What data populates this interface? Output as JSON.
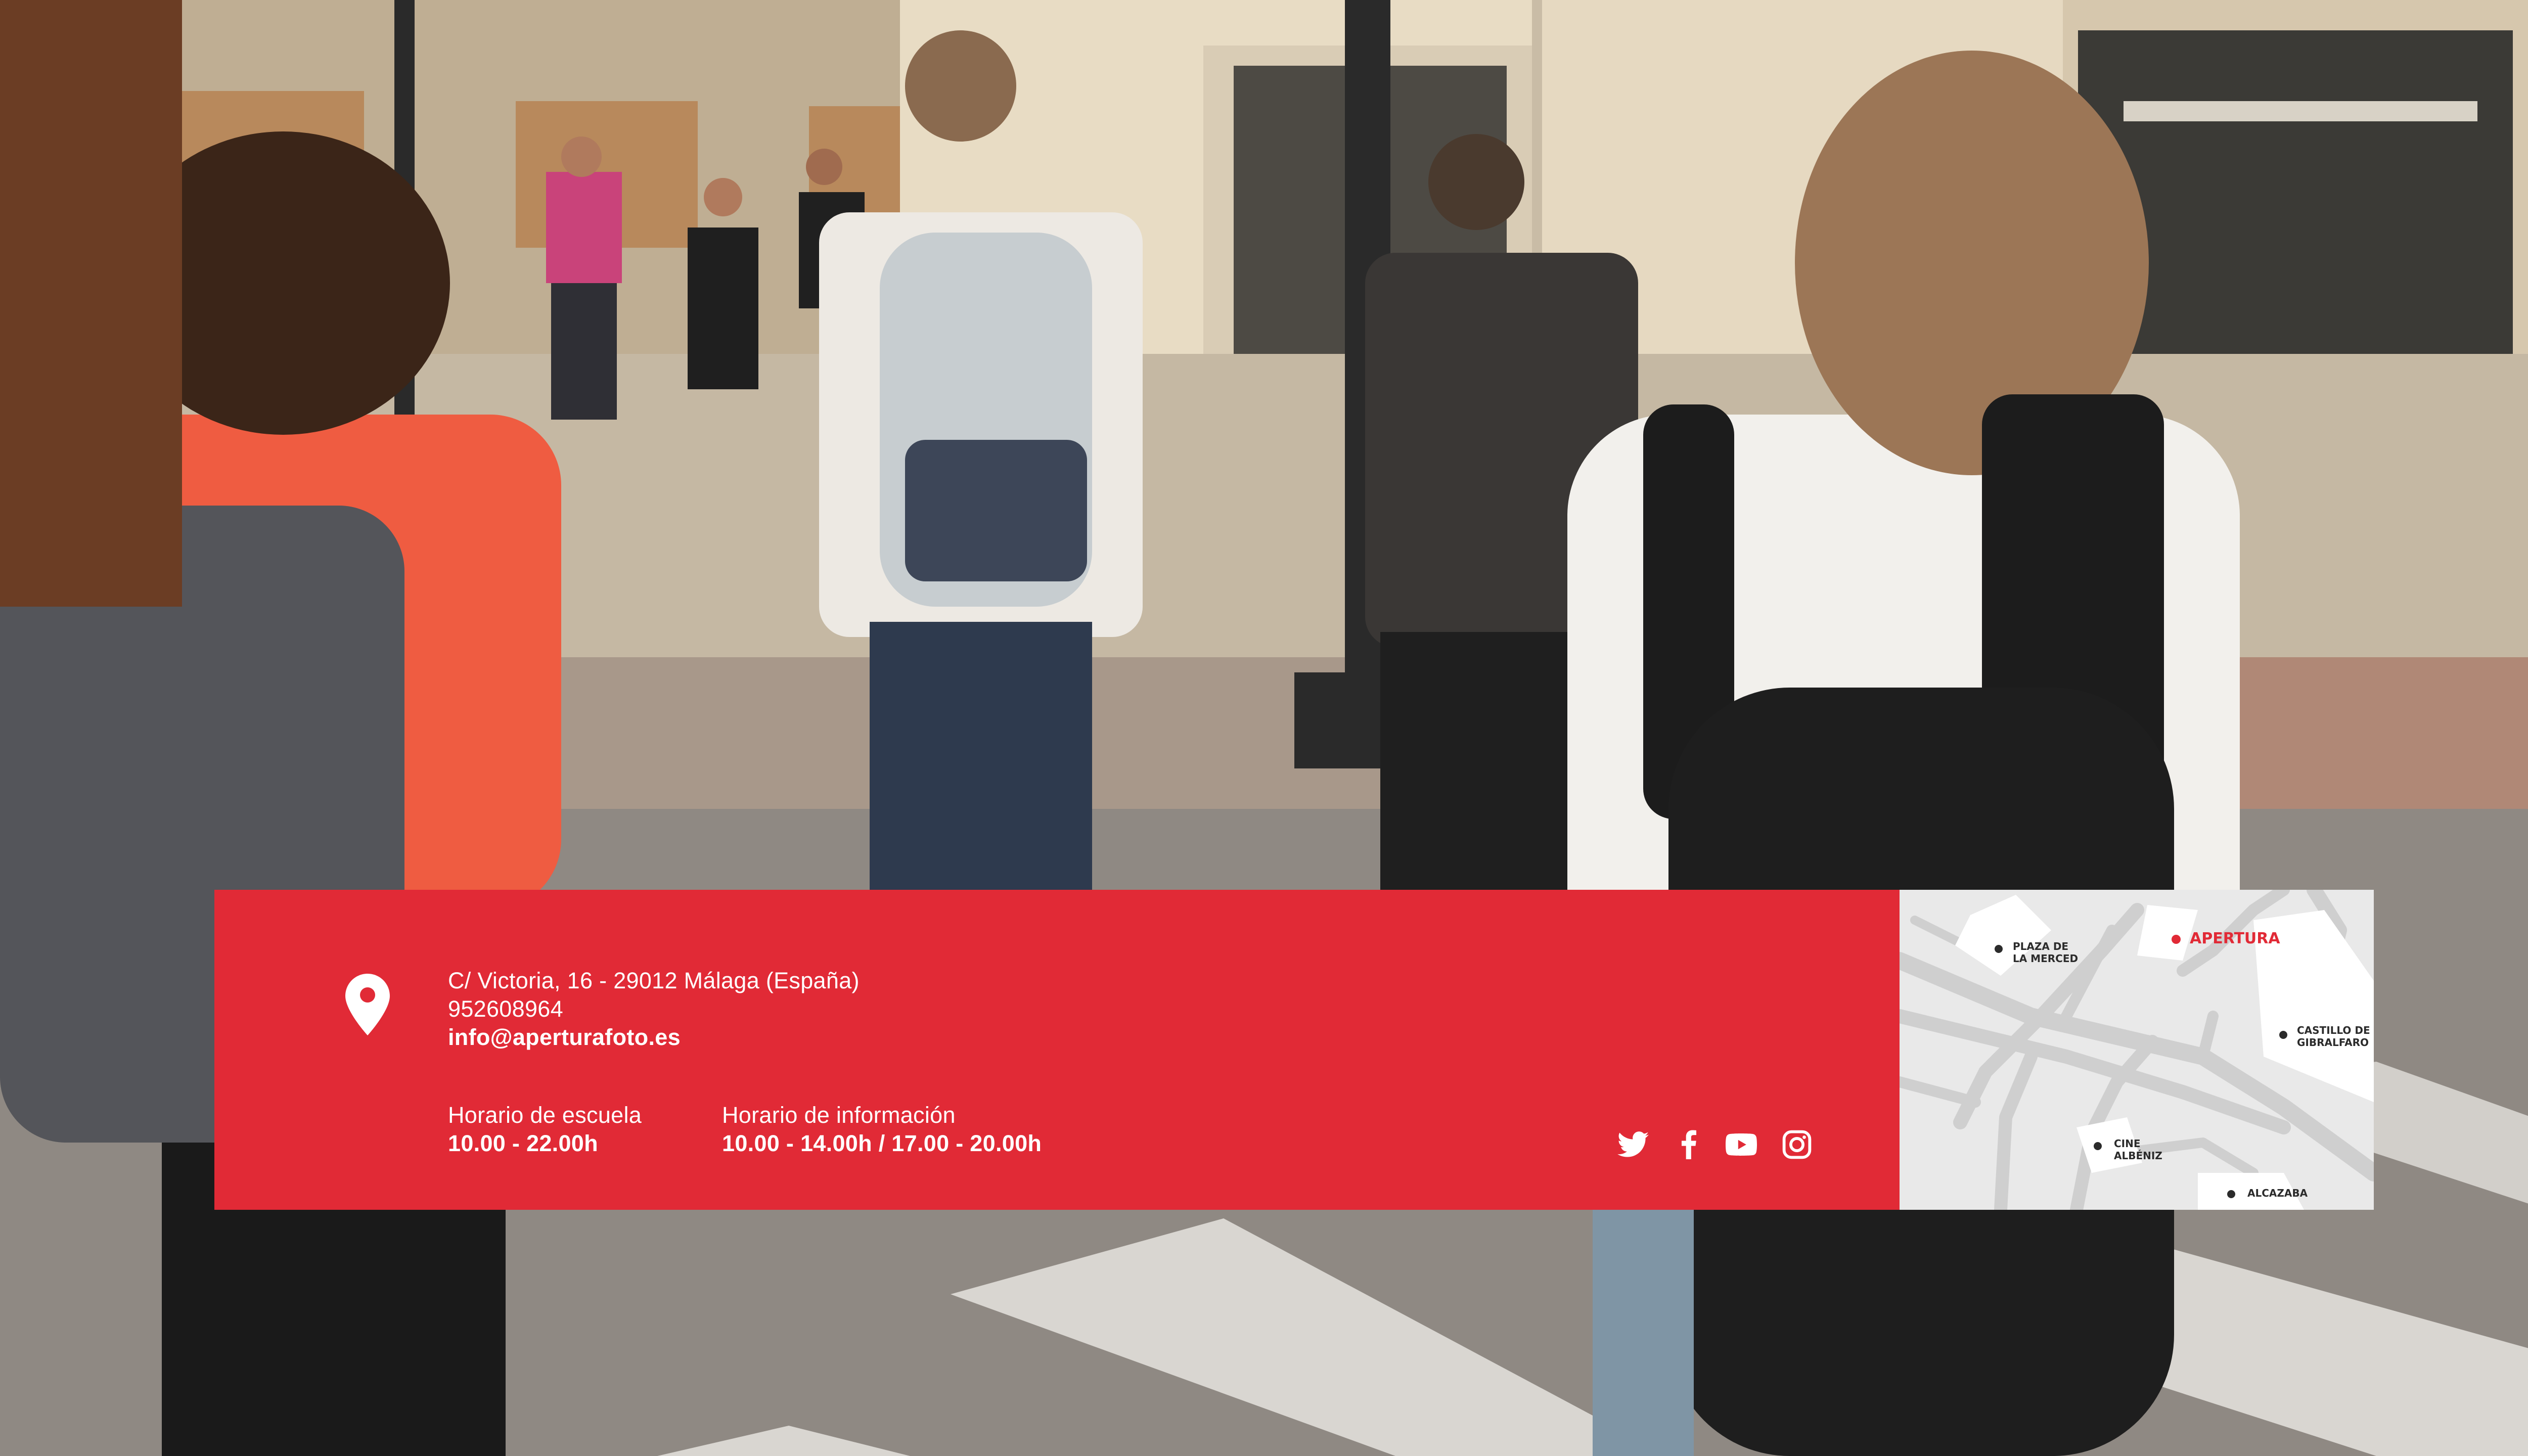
{
  "contact": {
    "address": "C/ Victoria, 16 - 29012 Málaga (España)",
    "phone": "952608964",
    "email": "info@aperturafoto.es"
  },
  "hours": {
    "school_label": "Horario de escuela",
    "school_value": "10.00 - 22.00h",
    "info_label": "Horario de información",
    "info_value": "10.00 - 14.00h / 17.00 - 20.00h"
  },
  "social": {
    "icons": [
      "twitter-icon",
      "facebook-icon",
      "youtube-icon",
      "instagram-icon"
    ]
  },
  "map": {
    "labels": {
      "plaza": "PLAZA DE\nLA MERCED",
      "apertura": "APERTURA",
      "castillo": "CASTILLO DE\nGIBRALFARO",
      "cine": "CINE\nALBÉNIZ",
      "alcazaba": "ALCAZABA"
    }
  },
  "icons": {
    "location": "location-pin-icon"
  },
  "colors": {
    "brand_red": "#e12a36",
    "text_on_red": "#ffffff",
    "map_background": "#e9e9e9",
    "map_streets": "#cfcfcf",
    "map_text": "#2b2b2b"
  }
}
